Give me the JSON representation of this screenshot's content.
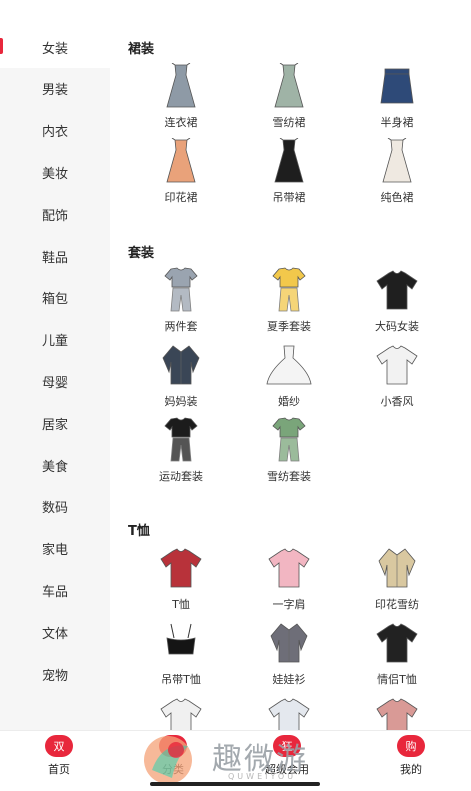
{
  "sidebar": {
    "items": [
      {
        "label": "女装",
        "active": true
      },
      {
        "label": "男装"
      },
      {
        "label": "内衣"
      },
      {
        "label": "美妆"
      },
      {
        "label": "配饰"
      },
      {
        "label": "鞋品"
      },
      {
        "label": "箱包"
      },
      {
        "label": "儿童"
      },
      {
        "label": "母婴"
      },
      {
        "label": "居家"
      },
      {
        "label": "美食"
      },
      {
        "label": "数码"
      },
      {
        "label": "家电"
      },
      {
        "label": "车品"
      },
      {
        "label": "文体"
      },
      {
        "label": "宠物"
      }
    ]
  },
  "sections": [
    {
      "title": "裙装",
      "items": [
        {
          "label": "连衣裙",
          "icon": "dress-icon",
          "color": "#8e9aa6"
        },
        {
          "label": "雪纺裙",
          "icon": "dress-icon",
          "color": "#9fb3a6"
        },
        {
          "label": "半身裙",
          "icon": "skirt-icon",
          "color": "#2e4a78"
        },
        {
          "label": "印花裙",
          "icon": "dress-icon",
          "color": "#e9a27a"
        },
        {
          "label": "吊带裙",
          "icon": "dress-icon",
          "color": "#1e1e1e"
        },
        {
          "label": "纯色裙",
          "icon": "dress-icon",
          "color": "#efe9e1"
        }
      ]
    },
    {
      "title": "套装",
      "items": [
        {
          "label": "两件套",
          "icon": "outfit-icon",
          "color": "#9aa4b0"
        },
        {
          "label": "夏季套装",
          "icon": "outfit-icon",
          "color": "#f2c84b"
        },
        {
          "label": "大码女装",
          "icon": "tshirt-icon",
          "color": "#1f1f1f"
        },
        {
          "label": "妈妈装",
          "icon": "blouse-icon",
          "color": "#3a4656"
        },
        {
          "label": "婚纱",
          "icon": "gown-icon",
          "color": "#f4f4f4"
        },
        {
          "label": "小香风",
          "icon": "tshirt-icon",
          "color": "#f2f2f2"
        },
        {
          "label": "运动套装",
          "icon": "outfit-icon",
          "color": "#1c1c1c"
        },
        {
          "label": "雪纺套装",
          "icon": "outfit-icon",
          "color": "#7aa57a"
        }
      ]
    },
    {
      "title": "T恤",
      "items": [
        {
          "label": "T恤",
          "icon": "tshirt-icon",
          "color": "#b8323a"
        },
        {
          "label": "一字肩",
          "icon": "tshirt-icon",
          "color": "#f2b6c2"
        },
        {
          "label": "印花雪纺",
          "icon": "blouse-icon",
          "color": "#d9c8a0"
        },
        {
          "label": "吊带T恤",
          "icon": "camisole-icon",
          "color": "#151515"
        },
        {
          "label": "娃娃衫",
          "icon": "blouse-icon",
          "color": "#6e6e78"
        },
        {
          "label": "情侣T恤",
          "icon": "tshirt-icon",
          "color": "#222222"
        },
        {
          "label": "",
          "icon": "tshirt-icon",
          "color": "#f0f0f0"
        },
        {
          "label": "",
          "icon": "tshirt-icon",
          "color": "#e4e8ee"
        },
        {
          "label": "",
          "icon": "tshirt-icon",
          "color": "#d99a96"
        }
      ]
    }
  ],
  "tabbar": {
    "tabs": [
      {
        "badge": "双",
        "label": "首页"
      },
      {
        "badge": "",
        "label": "分类"
      },
      {
        "badge": "狂",
        "label": "超级会用"
      },
      {
        "badge": "购",
        "label": "我的"
      }
    ]
  },
  "watermark": {
    "text": "趣微游",
    "sub": "QUWEIYOU"
  },
  "colors": {
    "accent": "#e8273c",
    "sidebar_bg": "#f6f6f6"
  }
}
